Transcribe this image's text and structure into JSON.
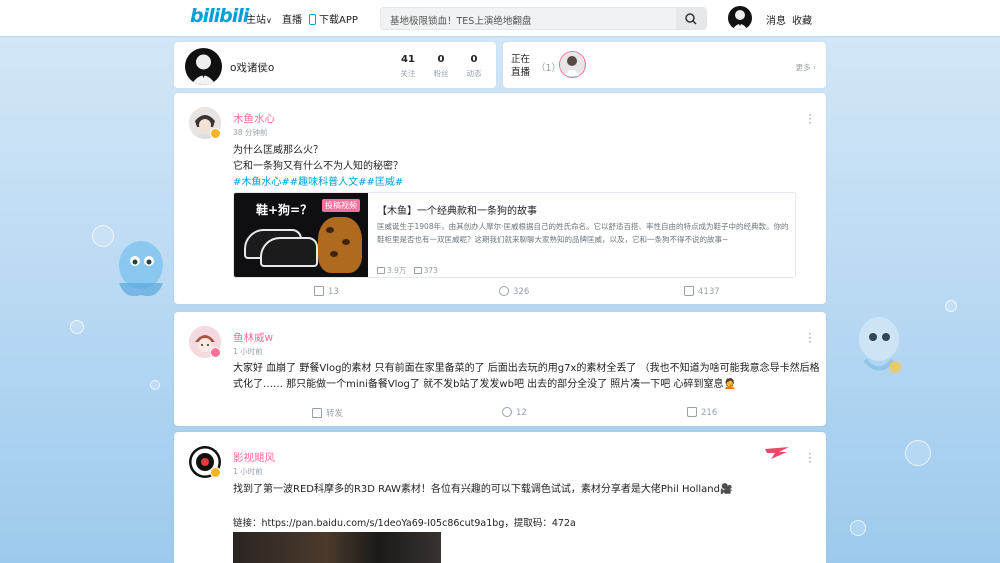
{
  "topbar": {
    "logo": "bilibili",
    "nav_home": "主站",
    "nav_live": "直播",
    "nav_download": "下载APP",
    "search_placeholder": "基地极限锁血！TES上演绝地翻盘",
    "messages": "消息",
    "favorites": "收藏"
  },
  "profile": {
    "name": "o戏诸侯o",
    "stats": [
      {
        "num": "41",
        "label": "关注"
      },
      {
        "num": "0",
        "label": "粉丝"
      },
      {
        "num": "0",
        "label": "动态"
      }
    ]
  },
  "live": {
    "label_line1": "正在",
    "label_line2": "直播",
    "count": "（1）",
    "more": "更多"
  },
  "posts": [
    {
      "author": "木鱼水心",
      "time": "38 分钟前",
      "lines": [
        "为什么匡威那么火？",
        "它和一条狗又有什么不为人知的秘密？"
      ],
      "tags": "#木鱼水心##趣味科普人文##匡威#",
      "video": {
        "thumb_title": "鞋+狗=？",
        "thumb_tag": "投稿视频",
        "title": "【木鱼】一个经典款和一条狗的故事",
        "desc": "匡威诞生于1908年，由其创办人摩尔·匡威根据自己的姓氏命名。它以舒适百搭、率性自由的特点成为鞋子中的经典款。你的鞋柜里是否也有一双匡威呢？这期我们就来聊聊大家熟知的品牌匡威，以及，它和一条狗不得不说的故事~",
        "views": "3.9万",
        "danmaku": "373"
      },
      "share": "13",
      "comments": "326",
      "likes": "4137"
    },
    {
      "author": "鱼林威w",
      "time": "1 小时前",
      "lines": [
        "大家好 血崩了 野餐Vlog的素材 只有前面在家里备菜的了 后面出去玩的用g7x的素材全丢了 （我也不知道为啥可能我意念导卡然后格",
        "式化了…… 那只能做一个mini备餐Vlog了 就不发b站了发发wb吧 出去的部分全没了 照片凑一下吧 心碎到窒息🤦"
      ],
      "share": "转发",
      "comments": "12",
      "likes": "216"
    },
    {
      "author": "影视飓风",
      "time": "1 小时前",
      "line1": "找到了第一波RED科摩多的R3D RAW素材！各位有兴趣的可以下载调色试试，素材分享者是大佬Phil Holland🎥",
      "link": "链接：https://pan.baidu.com/s/1deoYa69-I05c86cut9a1bg，提取码：472a"
    }
  ],
  "colors": {
    "brand": "#00a1d6",
    "pink": "#fb7299",
    "muted": "#99a2aa"
  }
}
